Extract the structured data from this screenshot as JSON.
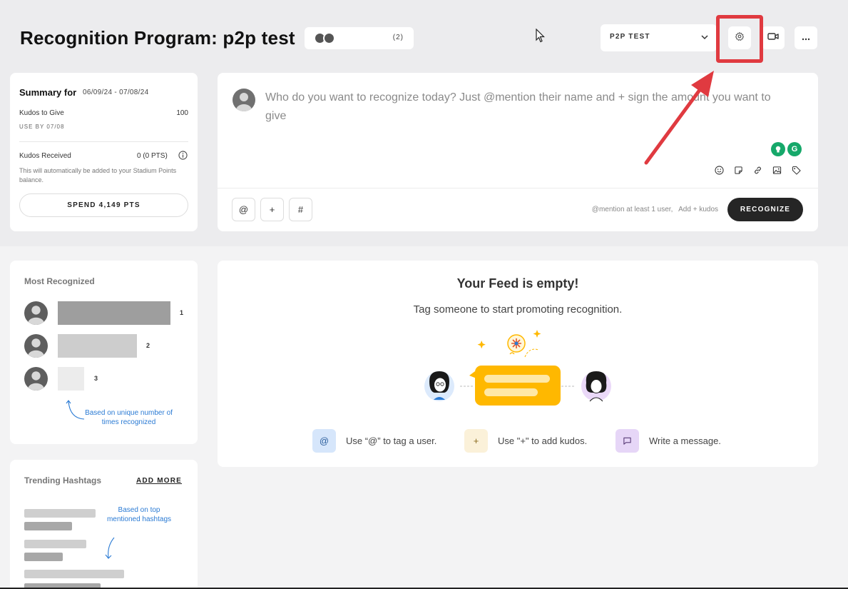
{
  "header": {
    "title": "Recognition Program: p2p test",
    "participant_count": "(2)",
    "program_select": "P2P TEST"
  },
  "summary": {
    "heading": "Summary for",
    "date_range": "06/09/24 - 07/08/24",
    "kudos_to_give_label": "Kudos to Give",
    "kudos_to_give_value": "100",
    "use_by": "USE BY 07/08",
    "kudos_received_label": "Kudos Received",
    "kudos_received_value": "0 (0 PTS)",
    "note": "This will automatically be added to your Stadium Points balance.",
    "spend_button": "SPEND 4,149 PTS"
  },
  "composer": {
    "placeholder": "Who do you want to recognize today? Just @mention their name and + sign the amount you want to give",
    "insert_buttons": [
      "@",
      "+",
      "#"
    ],
    "hint": "@mention at least 1 user,   Add + kudos",
    "submit": "RECOGNIZE",
    "toolbar_icons": [
      "emoji-icon",
      "sticker-icon",
      "link-icon",
      "image-icon",
      "tag-icon"
    ]
  },
  "most_recognized": {
    "title": "Most Recognized",
    "ranks": [
      "1",
      "2",
      "3"
    ],
    "note": "Based on unique number of times recognized"
  },
  "trending": {
    "title": "Trending Hashtags",
    "add_more": "ADD MORE",
    "note": "Based on top mentioned hashtags"
  },
  "feed": {
    "title": "Your Feed is empty!",
    "subtitle": "Tag someone to start promoting recognition.",
    "hints": [
      {
        "icon": "@",
        "text": "Use “@” to tag a user."
      },
      {
        "icon": "+",
        "text": "Use \"+\" to add kudos."
      },
      {
        "icon": "message-icon",
        "text": "Write a message."
      }
    ]
  },
  "colors": {
    "highlight": "#e03a40",
    "primary_button": "#252525",
    "note_blue": "#2b7bd4",
    "illustration_yellow": "#ffb800"
  }
}
